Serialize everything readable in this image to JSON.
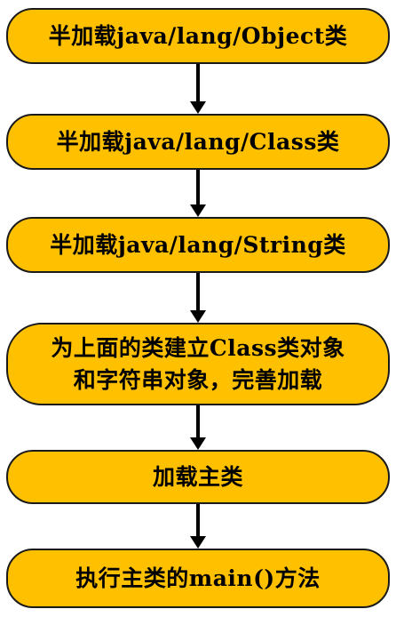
{
  "flowchart": {
    "steps": [
      {
        "text": "半加载java/lang/Object类"
      },
      {
        "text": "半加载java/lang/Class类"
      },
      {
        "text": "半加载java/lang/String类"
      },
      {
        "text": "为上面的类建立Class类对象\n和字符串对象，完善加载"
      },
      {
        "text": "加载主类"
      },
      {
        "text": "执行主类的main()方法"
      }
    ],
    "colors": {
      "box_fill": "#ffc000",
      "box_border": "#1a1a1a",
      "arrow": "#000000",
      "text": "#000000"
    }
  }
}
